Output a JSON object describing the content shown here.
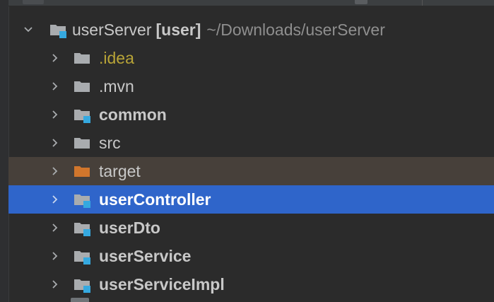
{
  "colors": {
    "background": "#2b2b2b",
    "selection": "#2f65ca",
    "excluded_row": "#47403a",
    "idea_text": "#b8a437",
    "module_badge": "#35a9e0",
    "excluded_folder": "#d1762c",
    "folder_grey": "#a9acaf"
  },
  "tree": {
    "root": {
      "name": "userServer",
      "module": "[user]",
      "path": "~/Downloads/userServer",
      "expanded": true,
      "icon": "module-folder-icon"
    },
    "children": [
      {
        "label": ".idea",
        "icon": "folder-icon",
        "state": "idea"
      },
      {
        "label": ".mvn",
        "icon": "folder-icon",
        "state": "normal"
      },
      {
        "label": "common",
        "icon": "module-folder-icon",
        "state": "module"
      },
      {
        "label": "src",
        "icon": "folder-icon",
        "state": "normal"
      },
      {
        "label": "target",
        "icon": "excluded-folder-icon",
        "state": "excluded"
      },
      {
        "label": "userController",
        "icon": "module-folder-icon",
        "state": "selected"
      },
      {
        "label": "userDto",
        "icon": "module-folder-icon",
        "state": "module"
      },
      {
        "label": "userService",
        "icon": "module-folder-icon",
        "state": "module"
      },
      {
        "label": "userServiceImpl",
        "icon": "module-folder-icon",
        "state": "module"
      }
    ]
  }
}
